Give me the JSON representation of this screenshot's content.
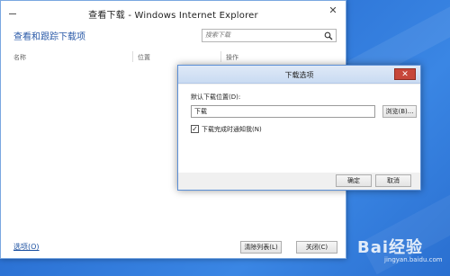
{
  "ie_window": {
    "title": "查看下载 - Windows Internet Explorer",
    "heading": "查看和跟踪下载项",
    "search": {
      "placeholder": "搜索下载"
    },
    "columns": [
      "名称",
      "位置",
      "操作"
    ],
    "footer": {
      "options_link": "选项(O)",
      "clear_list": "清除列表(L)",
      "close": "关闭(C)"
    }
  },
  "dialog": {
    "title": "下载选项",
    "default_location_label": "默认下载位置(D):",
    "path_value": "下载",
    "browse": "浏览(B)...",
    "notify_checked": true,
    "notify_label": "下载完成时通知我(N)",
    "ok": "确定",
    "cancel": "取消",
    "close_glyph": "✕"
  },
  "watermark": {
    "text": "Bai经验",
    "url": "jingyan.baidu.com"
  },
  "colors": {
    "desktop": "#2d74d6",
    "heading": "#2a5aa8",
    "dialog_close": "#c7473a"
  }
}
